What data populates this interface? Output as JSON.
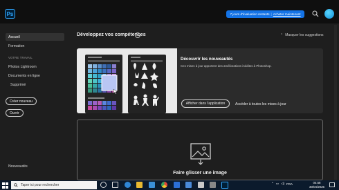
{
  "app": {
    "logo": "Ps"
  },
  "topbar": {
    "trial_text": "7 jours d'évaluation restants",
    "trial_sep": "|",
    "buy_text": "Acheter maintenant",
    "search_icon": "search-icon",
    "avatar_icon": "user-avatar-icon"
  },
  "sidebar": {
    "items": [
      {
        "label": "Accueil"
      },
      {
        "label": "Formation"
      }
    ],
    "heading": "VOTRE TRAVAIL",
    "work_items": [
      {
        "label": "Photos Lightroom"
      },
      {
        "label": "Documents en ligne"
      },
      {
        "label": "Supprimé"
      }
    ],
    "create_button": "Créer nouveau",
    "open_button": "Ouvrir",
    "whats_new": "Nouveautés"
  },
  "main": {
    "title": "Développez vos compétences",
    "hide_label": "Masquer les suggestions",
    "card": {
      "title": "Découvrir les nouveautés",
      "description": "Ces mises à jour apportent des améliorations inédites à Photoshop.",
      "button": "Afficher dans l'application",
      "link": "Accéder à toutes les mises à jour"
    },
    "drop_label": "Faire glisser une image"
  },
  "taskbar": {
    "search_placeholder": "Taper ici pour rechercher",
    "lang": "FRA",
    "time": "04:58",
    "date": "30/04/2025"
  },
  "colors": {
    "accent": "#1473e6",
    "ps_blue": "#31a8ff",
    "background": "#1e1e1e"
  }
}
